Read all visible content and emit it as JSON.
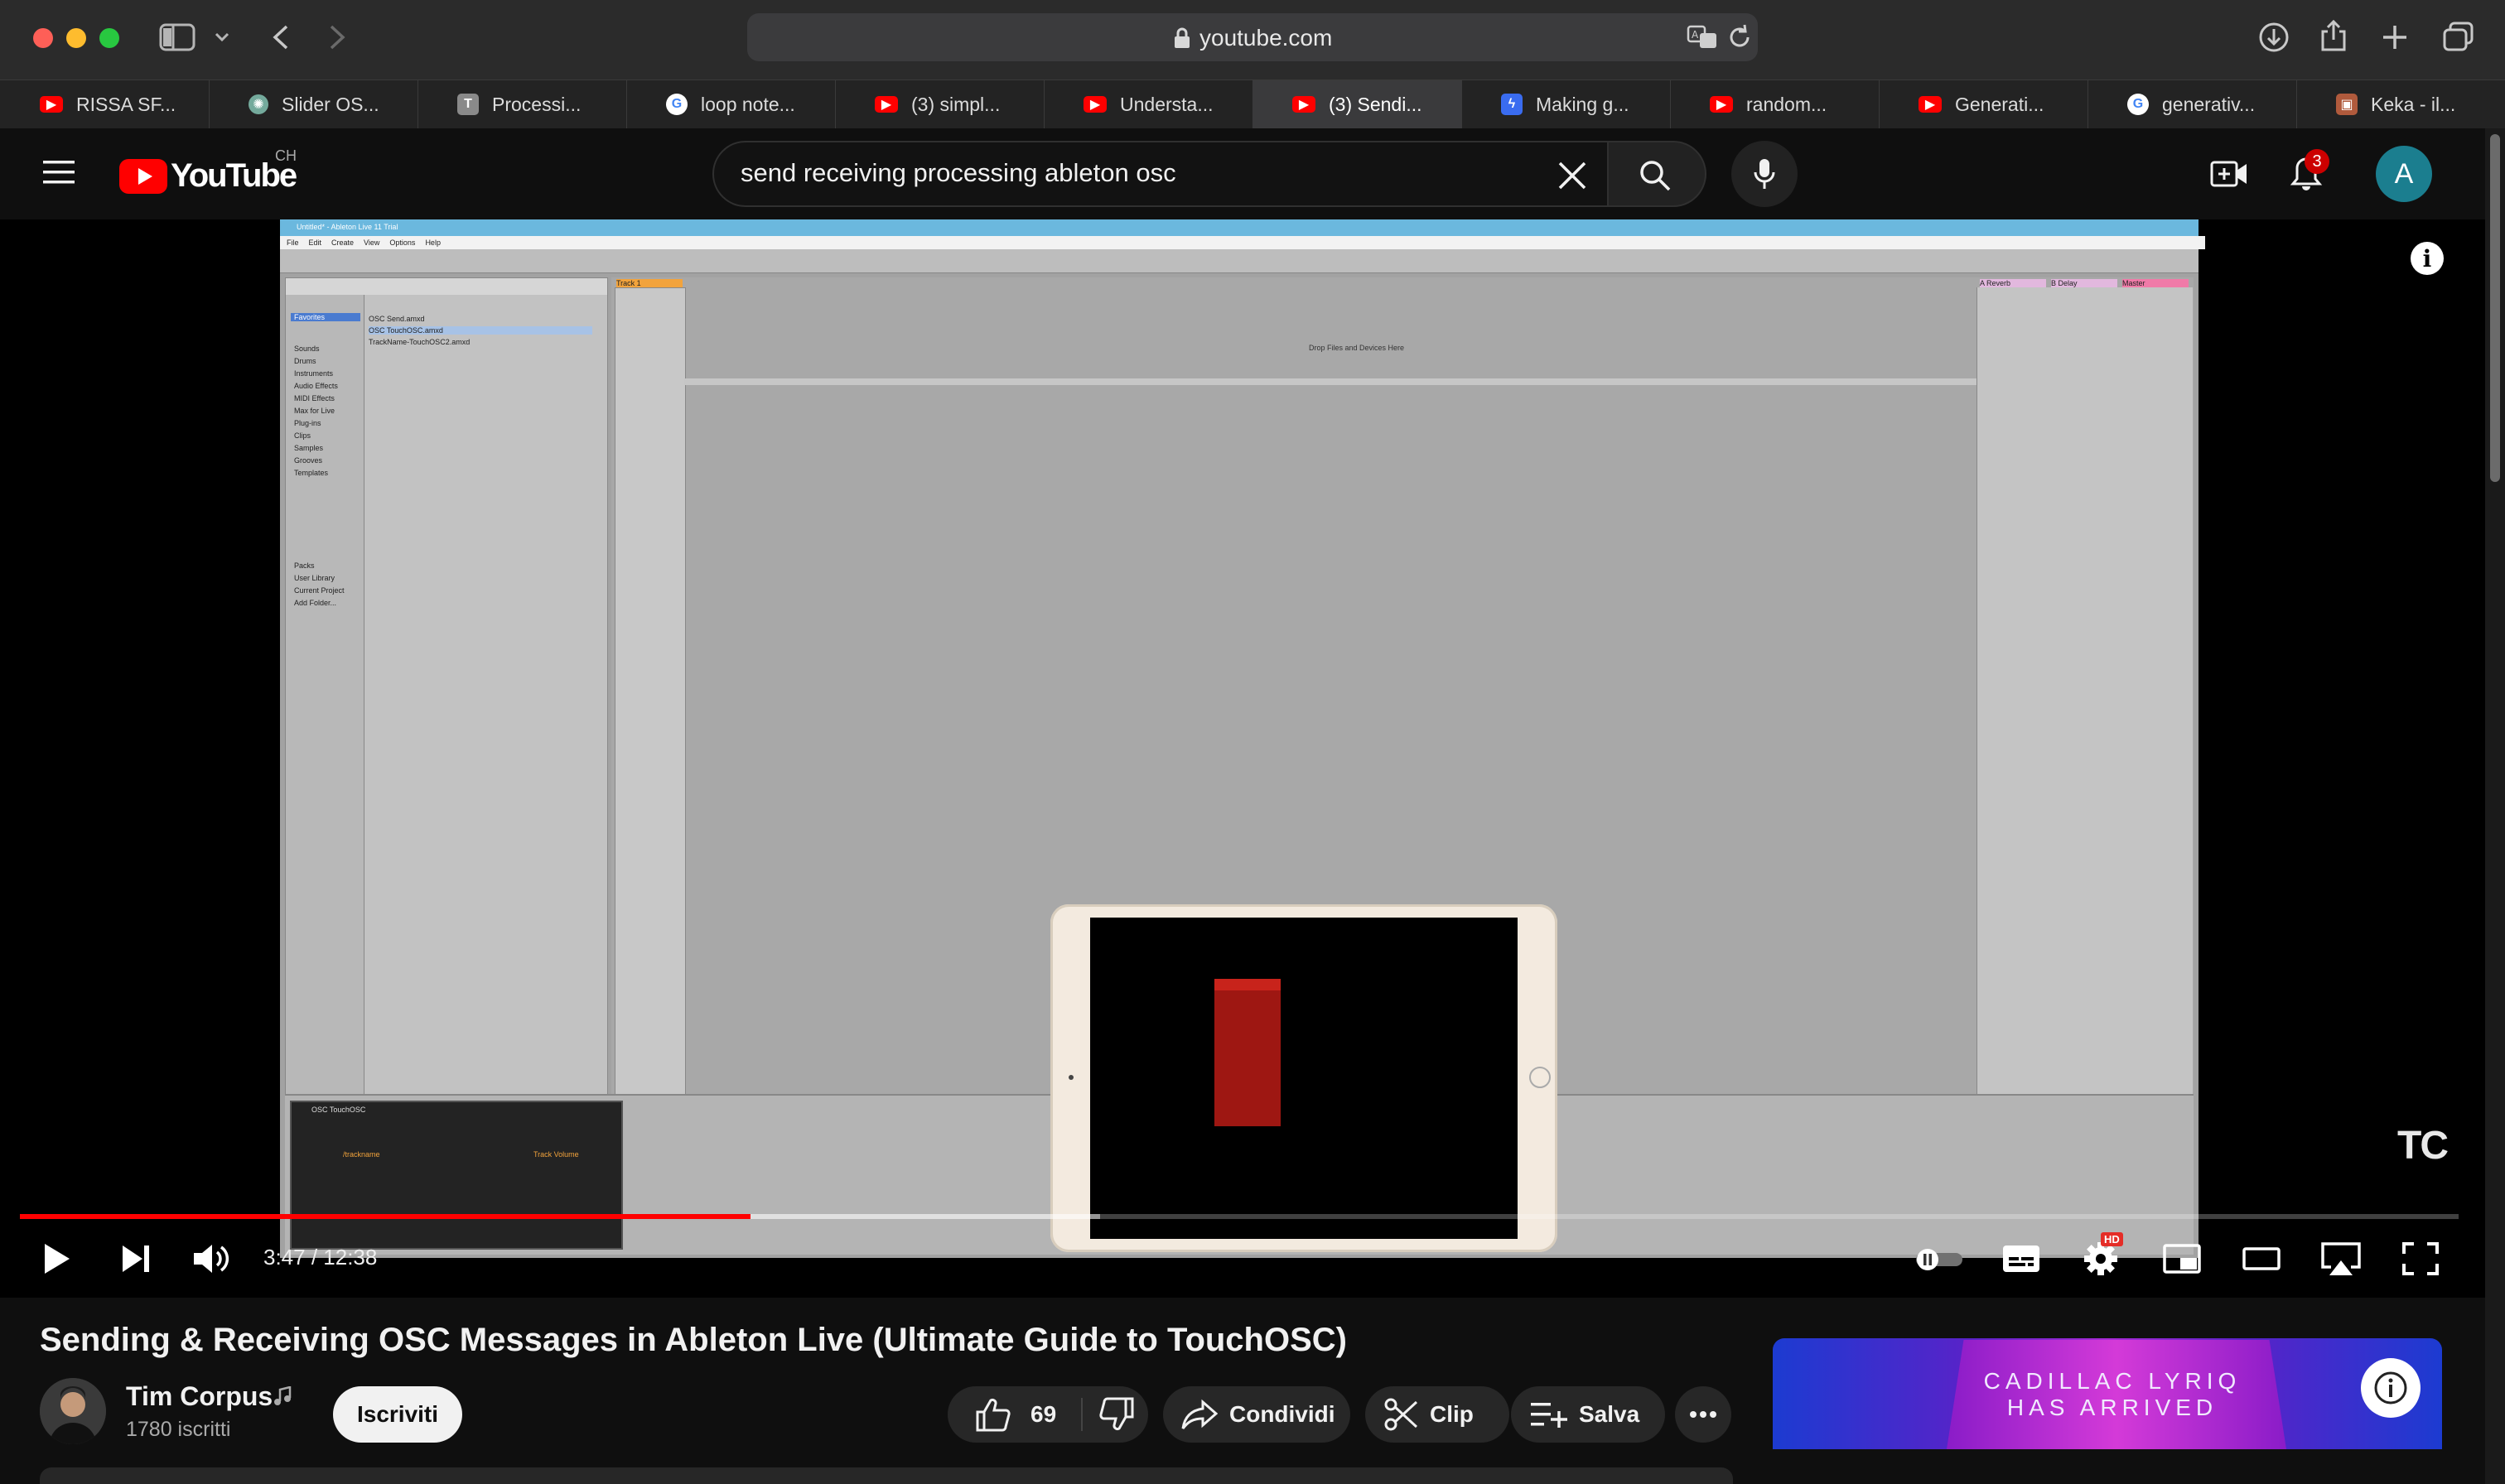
{
  "browser": {
    "url": "youtube.com",
    "tabs": [
      {
        "label": "RISSA SF...",
        "icon": "youtube-icon",
        "color": "#ff0000"
      },
      {
        "label": "Slider OS...",
        "icon": "chatgpt-icon",
        "color": "#74aa9c"
      },
      {
        "label": "Processi...",
        "icon": "processing-icon",
        "color": "#8a8a8a"
      },
      {
        "label": "loop note...",
        "icon": "google-icon",
        "color": "#4285f4"
      },
      {
        "label": "(3) simpl...",
        "icon": "youtube-icon",
        "color": "#ff0000"
      },
      {
        "label": "Understa...",
        "icon": "youtube-icon",
        "color": "#ff0000"
      },
      {
        "label": "(3) Sendi...",
        "icon": "youtube-icon",
        "color": "#ff0000",
        "active": true
      },
      {
        "label": "Making g...",
        "icon": "bolt-icon",
        "color": "#3a6cf0"
      },
      {
        "label": "random...",
        "icon": "youtube-icon",
        "color": "#ff0000"
      },
      {
        "label": "Generati...",
        "icon": "youtube-icon",
        "color": "#ff0000"
      },
      {
        "label": "generativ...",
        "icon": "google-icon",
        "color": "#4285f4"
      },
      {
        "label": "Keka - il...",
        "icon": "keka-icon",
        "color": "#b05a3c"
      }
    ]
  },
  "youtube": {
    "logo_text": "YouTube",
    "region": "CH",
    "search_query": "send receiving processing ableton osc",
    "notification_count": "3",
    "avatar_letter": "A"
  },
  "player": {
    "time": "3:47 / 12:38",
    "progress": 0.2995,
    "buffered": 0.443,
    "hd_badge": "HD",
    "watermark": "TC",
    "ableton_title": "Untitled* - Ableton Live 11 Trial",
    "ableton_menu": [
      "File",
      "Edit",
      "Create",
      "View",
      "Options",
      "Help"
    ],
    "ableton_files": [
      "OSC Send.amxd",
      "OSC TouchOSC.amxd",
      "TrackName-TouchOSC2.amxd"
    ],
    "ableton_collections": [
      "Favorites"
    ],
    "ableton_categories": [
      "Sounds",
      "Drums",
      "Instruments",
      "Audio Effects",
      "MIDI Effects",
      "Max for Live",
      "Plug-ins",
      "Clips",
      "Samples",
      "Grooves",
      "Templates"
    ],
    "ableton_places": [
      "Packs",
      "User Library",
      "Current Project",
      "Add Folder..."
    ],
    "ableton_tracks": [
      "Track 1",
      "A Reverb",
      "B Delay",
      "Master"
    ],
    "ableton_drop_hint": "Drop Files and Devices Here",
    "device_name": "OSC TouchOSC",
    "device_address": "/trackname",
    "device_param": "Track Volume"
  },
  "video": {
    "title": "Sending & Receiving OSC Messages in Ableton Live (Ultimate Guide to TouchOSC)",
    "channel": "Tim Corpus",
    "subscribers": "1780 iscritti",
    "subscribe_label": "Iscriviti",
    "likes": "69",
    "share_label": "Condividi",
    "clip_label": "Clip",
    "save_label": "Salva"
  },
  "ad": {
    "line1": "CADILLAC LYRIQ",
    "line2": "HAS ARRIVED"
  }
}
